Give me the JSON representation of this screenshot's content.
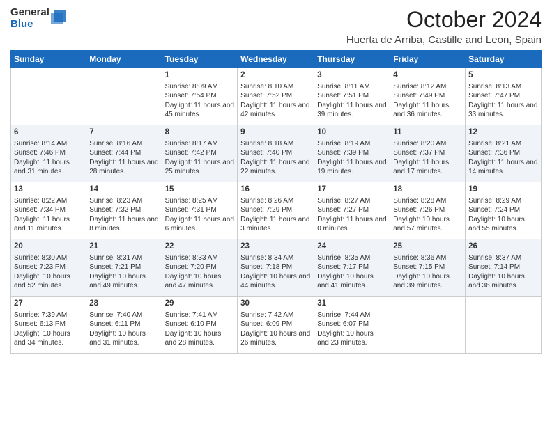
{
  "logo": {
    "general": "General",
    "blue": "Blue"
  },
  "header": {
    "month": "October 2024",
    "location": "Huerta de Arriba, Castille and Leon, Spain"
  },
  "weekdays": [
    "Sunday",
    "Monday",
    "Tuesday",
    "Wednesday",
    "Thursday",
    "Friday",
    "Saturday"
  ],
  "weeks": [
    [
      {
        "day": "",
        "sunrise": "",
        "sunset": "",
        "daylight": ""
      },
      {
        "day": "",
        "sunrise": "",
        "sunset": "",
        "daylight": ""
      },
      {
        "day": "1",
        "sunrise": "Sunrise: 8:09 AM",
        "sunset": "Sunset: 7:54 PM",
        "daylight": "Daylight: 11 hours and 45 minutes."
      },
      {
        "day": "2",
        "sunrise": "Sunrise: 8:10 AM",
        "sunset": "Sunset: 7:52 PM",
        "daylight": "Daylight: 11 hours and 42 minutes."
      },
      {
        "day": "3",
        "sunrise": "Sunrise: 8:11 AM",
        "sunset": "Sunset: 7:51 PM",
        "daylight": "Daylight: 11 hours and 39 minutes."
      },
      {
        "day": "4",
        "sunrise": "Sunrise: 8:12 AM",
        "sunset": "Sunset: 7:49 PM",
        "daylight": "Daylight: 11 hours and 36 minutes."
      },
      {
        "day": "5",
        "sunrise": "Sunrise: 8:13 AM",
        "sunset": "Sunset: 7:47 PM",
        "daylight": "Daylight: 11 hours and 33 minutes."
      }
    ],
    [
      {
        "day": "6",
        "sunrise": "Sunrise: 8:14 AM",
        "sunset": "Sunset: 7:46 PM",
        "daylight": "Daylight: 11 hours and 31 minutes."
      },
      {
        "day": "7",
        "sunrise": "Sunrise: 8:16 AM",
        "sunset": "Sunset: 7:44 PM",
        "daylight": "Daylight: 11 hours and 28 minutes."
      },
      {
        "day": "8",
        "sunrise": "Sunrise: 8:17 AM",
        "sunset": "Sunset: 7:42 PM",
        "daylight": "Daylight: 11 hours and 25 minutes."
      },
      {
        "day": "9",
        "sunrise": "Sunrise: 8:18 AM",
        "sunset": "Sunset: 7:40 PM",
        "daylight": "Daylight: 11 hours and 22 minutes."
      },
      {
        "day": "10",
        "sunrise": "Sunrise: 8:19 AM",
        "sunset": "Sunset: 7:39 PM",
        "daylight": "Daylight: 11 hours and 19 minutes."
      },
      {
        "day": "11",
        "sunrise": "Sunrise: 8:20 AM",
        "sunset": "Sunset: 7:37 PM",
        "daylight": "Daylight: 11 hours and 17 minutes."
      },
      {
        "day": "12",
        "sunrise": "Sunrise: 8:21 AM",
        "sunset": "Sunset: 7:36 PM",
        "daylight": "Daylight: 11 hours and 14 minutes."
      }
    ],
    [
      {
        "day": "13",
        "sunrise": "Sunrise: 8:22 AM",
        "sunset": "Sunset: 7:34 PM",
        "daylight": "Daylight: 11 hours and 11 minutes."
      },
      {
        "day": "14",
        "sunrise": "Sunrise: 8:23 AM",
        "sunset": "Sunset: 7:32 PM",
        "daylight": "Daylight: 11 hours and 8 minutes."
      },
      {
        "day": "15",
        "sunrise": "Sunrise: 8:25 AM",
        "sunset": "Sunset: 7:31 PM",
        "daylight": "Daylight: 11 hours and 6 minutes."
      },
      {
        "day": "16",
        "sunrise": "Sunrise: 8:26 AM",
        "sunset": "Sunset: 7:29 PM",
        "daylight": "Daylight: 11 hours and 3 minutes."
      },
      {
        "day": "17",
        "sunrise": "Sunrise: 8:27 AM",
        "sunset": "Sunset: 7:27 PM",
        "daylight": "Daylight: 11 hours and 0 minutes."
      },
      {
        "day": "18",
        "sunrise": "Sunrise: 8:28 AM",
        "sunset": "Sunset: 7:26 PM",
        "daylight": "Daylight: 10 hours and 57 minutes."
      },
      {
        "day": "19",
        "sunrise": "Sunrise: 8:29 AM",
        "sunset": "Sunset: 7:24 PM",
        "daylight": "Daylight: 10 hours and 55 minutes."
      }
    ],
    [
      {
        "day": "20",
        "sunrise": "Sunrise: 8:30 AM",
        "sunset": "Sunset: 7:23 PM",
        "daylight": "Daylight: 10 hours and 52 minutes."
      },
      {
        "day": "21",
        "sunrise": "Sunrise: 8:31 AM",
        "sunset": "Sunset: 7:21 PM",
        "daylight": "Daylight: 10 hours and 49 minutes."
      },
      {
        "day": "22",
        "sunrise": "Sunrise: 8:33 AM",
        "sunset": "Sunset: 7:20 PM",
        "daylight": "Daylight: 10 hours and 47 minutes."
      },
      {
        "day": "23",
        "sunrise": "Sunrise: 8:34 AM",
        "sunset": "Sunset: 7:18 PM",
        "daylight": "Daylight: 10 hours and 44 minutes."
      },
      {
        "day": "24",
        "sunrise": "Sunrise: 8:35 AM",
        "sunset": "Sunset: 7:17 PM",
        "daylight": "Daylight: 10 hours and 41 minutes."
      },
      {
        "day": "25",
        "sunrise": "Sunrise: 8:36 AM",
        "sunset": "Sunset: 7:15 PM",
        "daylight": "Daylight: 10 hours and 39 minutes."
      },
      {
        "day": "26",
        "sunrise": "Sunrise: 8:37 AM",
        "sunset": "Sunset: 7:14 PM",
        "daylight": "Daylight: 10 hours and 36 minutes."
      }
    ],
    [
      {
        "day": "27",
        "sunrise": "Sunrise: 7:39 AM",
        "sunset": "Sunset: 6:13 PM",
        "daylight": "Daylight: 10 hours and 34 minutes."
      },
      {
        "day": "28",
        "sunrise": "Sunrise: 7:40 AM",
        "sunset": "Sunset: 6:11 PM",
        "daylight": "Daylight: 10 hours and 31 minutes."
      },
      {
        "day": "29",
        "sunrise": "Sunrise: 7:41 AM",
        "sunset": "Sunset: 6:10 PM",
        "daylight": "Daylight: 10 hours and 28 minutes."
      },
      {
        "day": "30",
        "sunrise": "Sunrise: 7:42 AM",
        "sunset": "Sunset: 6:09 PM",
        "daylight": "Daylight: 10 hours and 26 minutes."
      },
      {
        "day": "31",
        "sunrise": "Sunrise: 7:44 AM",
        "sunset": "Sunset: 6:07 PM",
        "daylight": "Daylight: 10 hours and 23 minutes."
      },
      {
        "day": "",
        "sunrise": "",
        "sunset": "",
        "daylight": ""
      },
      {
        "day": "",
        "sunrise": "",
        "sunset": "",
        "daylight": ""
      }
    ]
  ]
}
